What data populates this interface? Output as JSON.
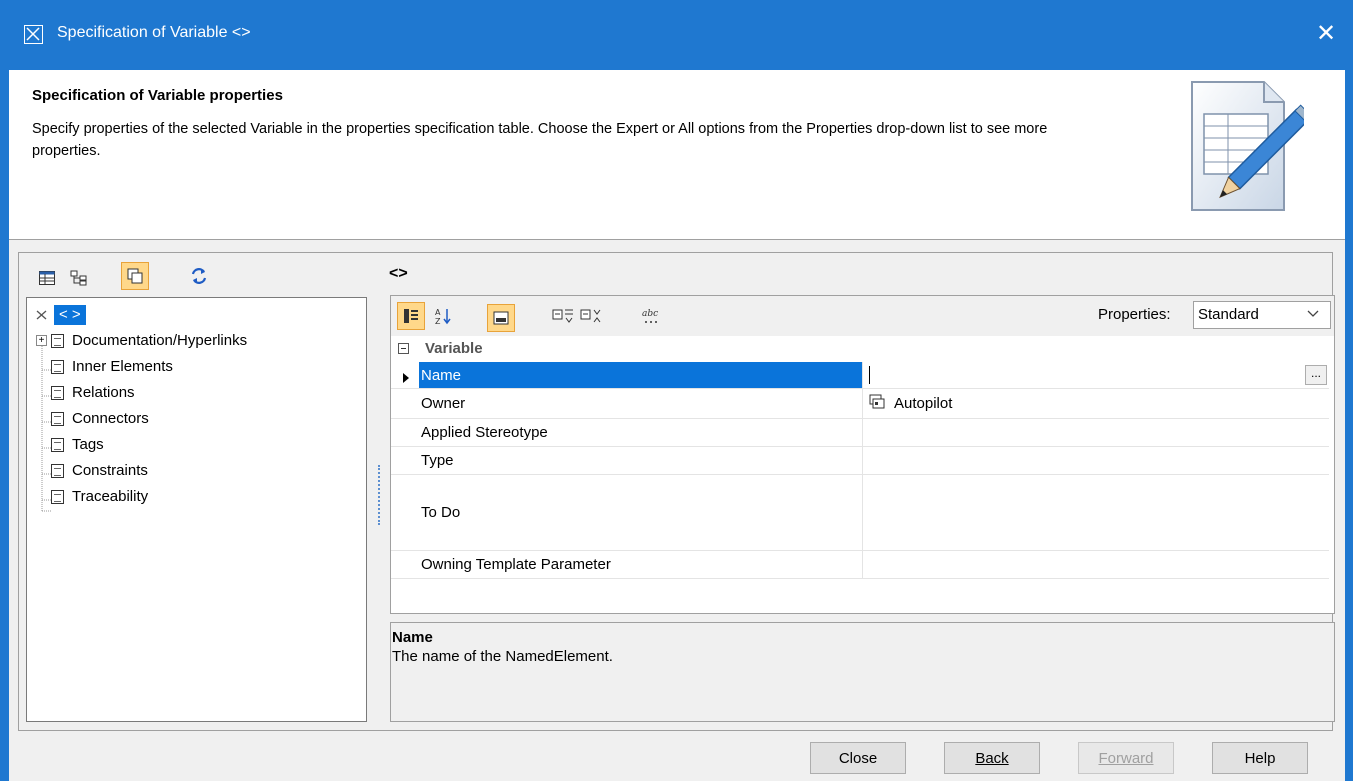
{
  "window": {
    "title": "Specification of Variable <>",
    "close_glyph": "✕"
  },
  "header": {
    "title": "Specification of Variable properties",
    "description": "Specify properties of the selected Variable in the properties specification table. Choose the Expert or All options from the Properties drop-down list to see more properties."
  },
  "left_toolbar": {
    "icons": [
      "table-view-icon",
      "tree-view-icon",
      "copy-icon",
      "refresh-icon"
    ]
  },
  "tree": {
    "root_label": "< >",
    "items": [
      {
        "label": "Documentation/Hyperlinks"
      },
      {
        "label": "Inner Elements"
      },
      {
        "label": "Relations"
      },
      {
        "label": "Connectors"
      },
      {
        "label": "Tags"
      },
      {
        "label": "Constraints"
      },
      {
        "label": "Traceability"
      }
    ]
  },
  "element_name": "<>",
  "properties": {
    "label": "Properties:",
    "selected": "Standard",
    "group": "Variable",
    "rows": [
      {
        "name": "Name",
        "value": ""
      },
      {
        "name": "Owner",
        "value": "Autopilot"
      },
      {
        "name": "Applied Stereotype",
        "value": ""
      },
      {
        "name": "Type",
        "value": ""
      },
      {
        "name": "To Do",
        "value": ""
      },
      {
        "name": "Owning Template Parameter",
        "value": ""
      }
    ],
    "ellipsis": "..."
  },
  "description": {
    "title": "Name",
    "text": "The name of the NamedElement."
  },
  "buttons": {
    "close": "Close",
    "back": "Back",
    "forward": "Forward",
    "help": "Help"
  },
  "colors": {
    "titlebar": "#1f78d0",
    "selection": "#0a74da",
    "active_toggle": "#ffd88a"
  }
}
